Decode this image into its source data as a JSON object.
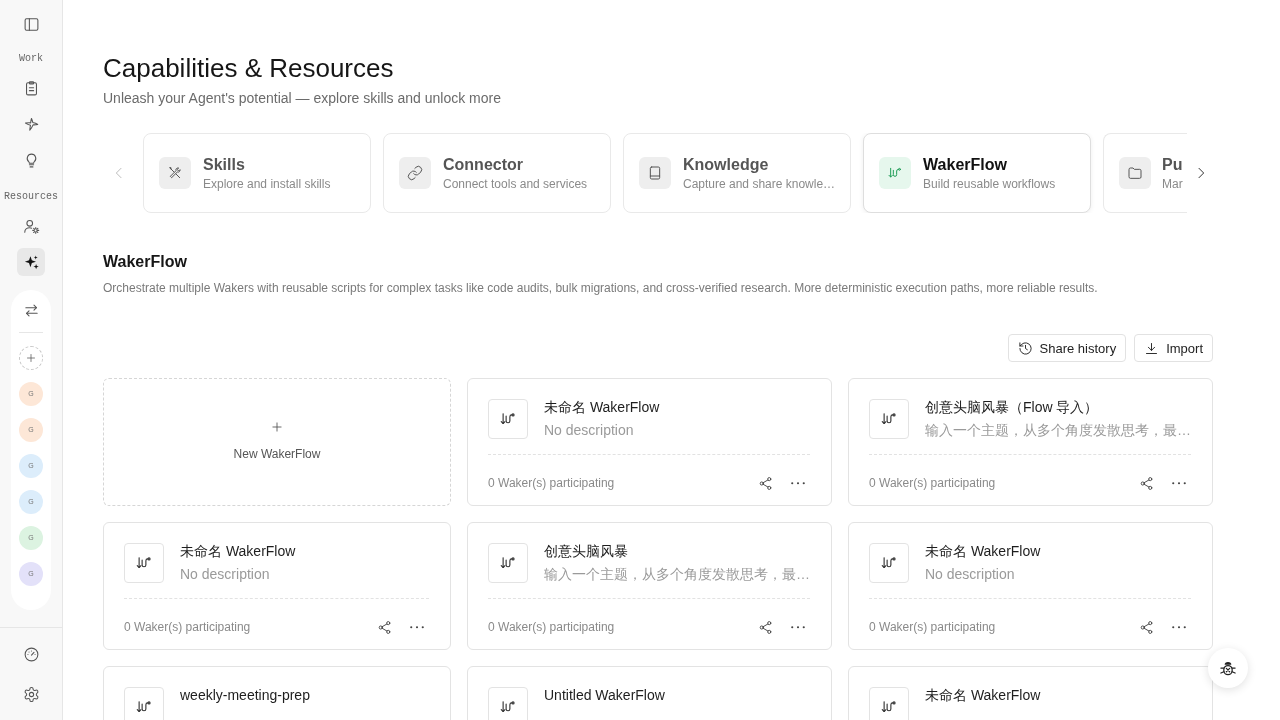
{
  "sidebar": {
    "groups": [
      {
        "label": "Work",
        "items": [
          {
            "selected": false
          },
          {
            "selected": false
          },
          {
            "selected": false
          }
        ]
      },
      {
        "label": "Resources",
        "items": [
          {
            "selected": false
          },
          {
            "selected": true
          }
        ]
      }
    ],
    "agents": [
      {
        "initial": "G",
        "color": "#fde7d7"
      },
      {
        "initial": "G",
        "color": "#fde7d7"
      },
      {
        "initial": "G",
        "color": "#dcedfb"
      },
      {
        "initial": "G",
        "color": "#dcedfb"
      },
      {
        "initial": "G",
        "color": "#dcf3e1"
      },
      {
        "initial": "G",
        "color": "#e3e1f9"
      }
    ]
  },
  "header": {
    "title": "Capabilities & Resources",
    "subtitle": "Unleash your Agent's potential — explore skills and unlock more"
  },
  "carousel": {
    "prev": {
      "disabled": true
    },
    "next": {
      "disabled": false
    },
    "items": [
      {
        "title": "Skills",
        "description": "Explore and install skills",
        "selected": false
      },
      {
        "title": "Connector",
        "description": "Connect tools and services",
        "selected": false
      },
      {
        "title": "Knowledge",
        "description": "Capture and share knowle…",
        "selected": false
      },
      {
        "title": "WakerFlow",
        "description": "Build reusable workflows",
        "selected": true
      },
      {
        "title": "Pu",
        "description": "Mar",
        "selected": false
      }
    ]
  },
  "section": {
    "title": "WakerFlow",
    "description": "Orchestrate multiple Wakers with reusable scripts for complex tasks like code audits, bulk migrations, and cross-verified research. More deterministic execution paths, more reliable results."
  },
  "actions": [
    {
      "label": "Share history"
    },
    {
      "label": "Import"
    }
  ],
  "new_flow": {
    "label": "New WakerFlow"
  },
  "flows": [
    {
      "title": "未命名 WakerFlow",
      "description": "No description",
      "participants": "0 Waker(s) participating"
    },
    {
      "title": "创意头脑风暴（Flow 导入）",
      "description": "输入一个主题，从多个角度发散思考，最…",
      "participants": "0 Waker(s) participating"
    },
    {
      "title": "未命名 WakerFlow",
      "description": "No description",
      "participants": "0 Waker(s) participating"
    },
    {
      "title": "创意头脑风暴",
      "description": "输入一个主题，从多个角度发散思考，最…",
      "participants": "0 Waker(s) participating"
    },
    {
      "title": "未命名 WakerFlow",
      "description": "No description",
      "participants": "0 Waker(s) participating"
    },
    {
      "title": "weekly-meeting-prep"
    },
    {
      "title": "Untitled WakerFlow"
    },
    {
      "title": "未命名 WakerFlow"
    }
  ]
}
